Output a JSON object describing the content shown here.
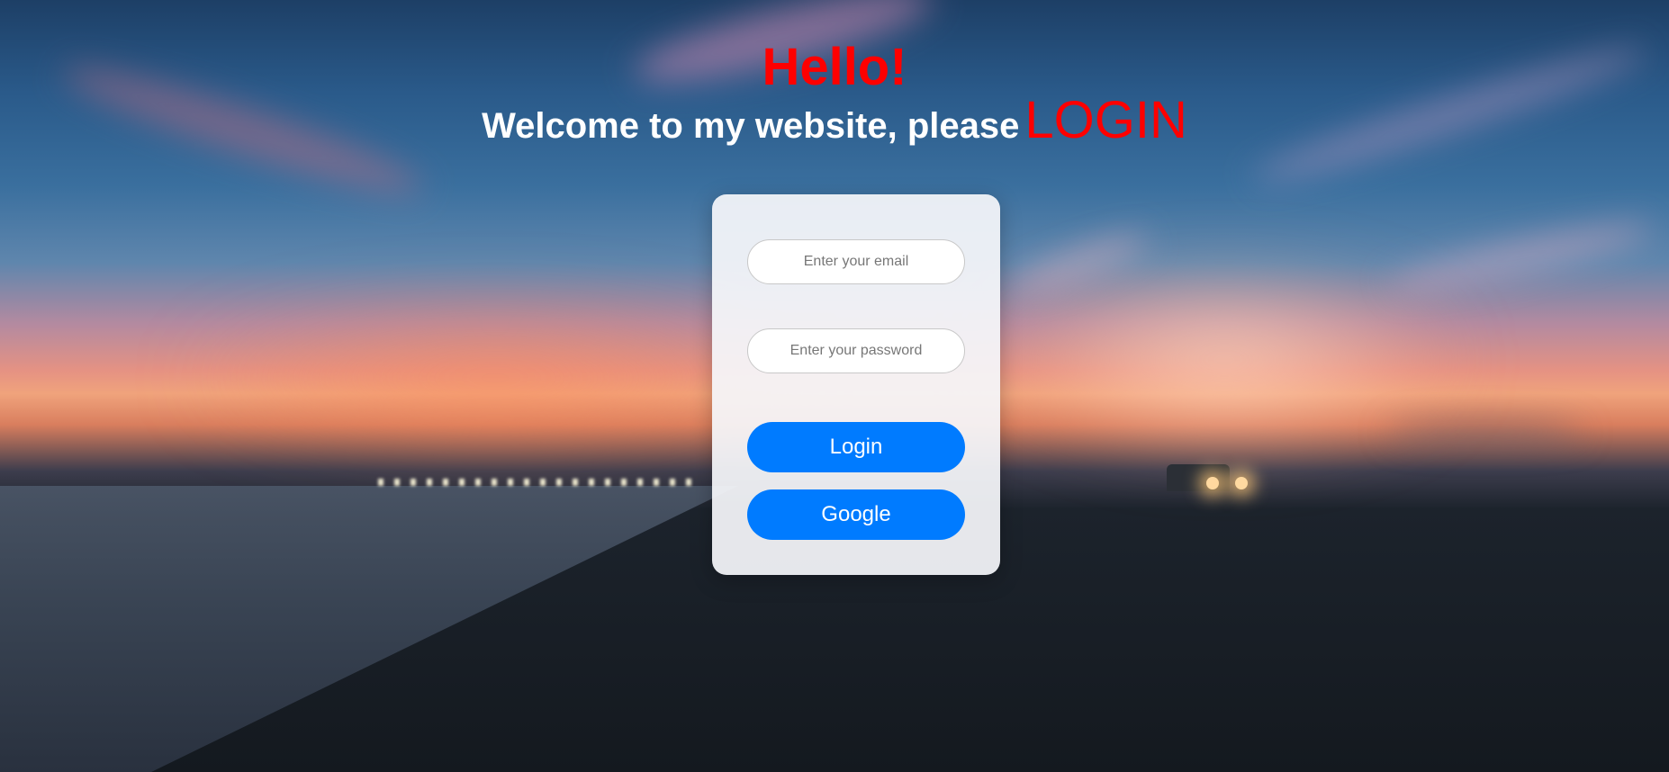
{
  "hero": {
    "greeting": "Hello!",
    "welcome_text": "Welcome to my website, please",
    "login_emphasis": "LOGIN"
  },
  "login_form": {
    "email_placeholder": "Enter your email",
    "password_placeholder": "Enter your password",
    "login_button_label": "Login",
    "google_button_label": "Google"
  },
  "colors": {
    "accent_red": "#ff0000",
    "button_blue": "#007bff",
    "card_background": "#f5f6fa"
  }
}
